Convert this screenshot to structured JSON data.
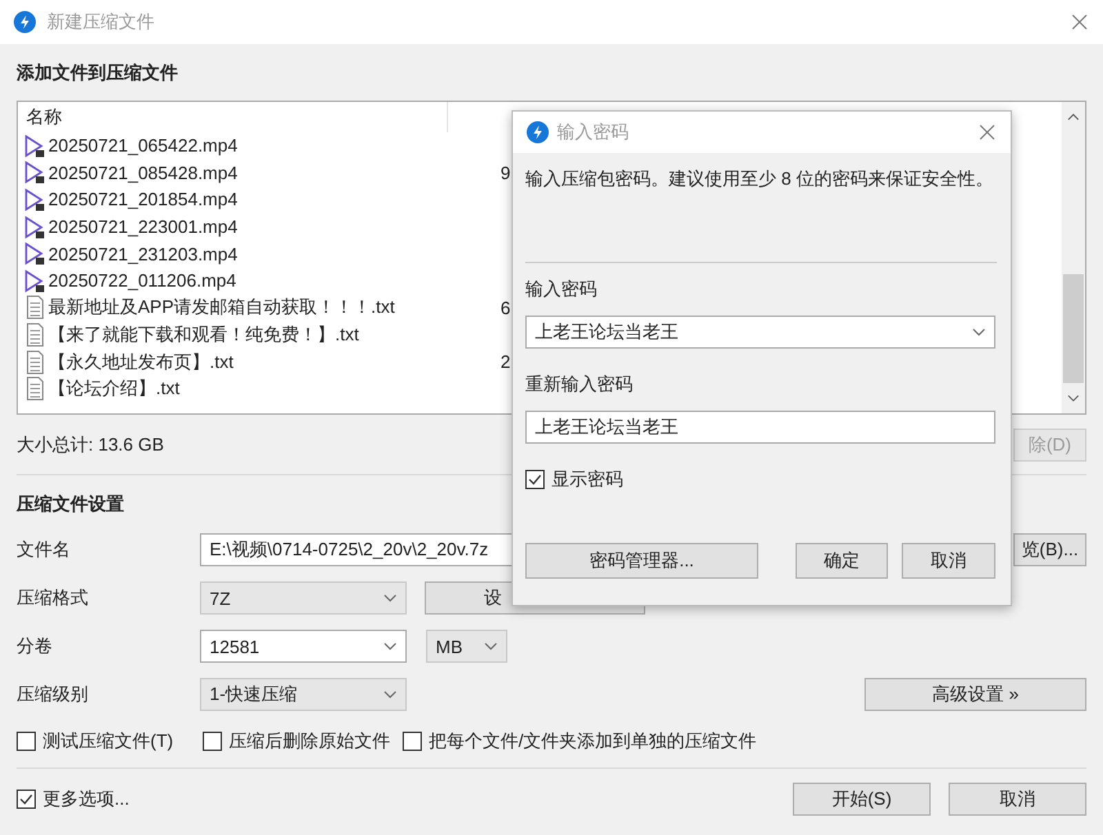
{
  "window": {
    "title": "新建压缩文件"
  },
  "files": {
    "heading": "添加文件到压缩文件",
    "columns": [
      "名称"
    ],
    "rows": [
      {
        "kind": "video",
        "name": "20250721_065422.mp4"
      },
      {
        "kind": "video",
        "name": "20250721_085428.mp4",
        "column_2": "9"
      },
      {
        "kind": "video",
        "name": "20250721_201854.mp4"
      },
      {
        "kind": "video",
        "name": "20250721_223001.mp4"
      },
      {
        "kind": "video",
        "name": "20250721_231203.mp4"
      },
      {
        "kind": "video",
        "name": "20250722_011206.mp4"
      },
      {
        "kind": "text",
        "name": "最新地址及APP请发邮箱自动获取！！！.txt",
        "column_2": "6"
      },
      {
        "kind": "text",
        "name": "【来了就能下载和观看！纯免费！】.txt"
      },
      {
        "kind": "text",
        "name": "【永久地址发布页】.txt",
        "column_2": "2"
      },
      {
        "kind": "text",
        "name": "【论坛介绍】.txt"
      }
    ]
  },
  "total_size": "大小总计: 13.6 GB",
  "delete_button": {
    "label": "除(D)",
    "disabled": true
  },
  "settings": {
    "heading": "压缩文件设置",
    "filename": {
      "label": "文件名",
      "value": "E:\\视频\\0714-0725\\2_20v\\2_20v.7z",
      "button": "览(B)..."
    },
    "format": {
      "label": "压缩格式",
      "value": "7Z",
      "editable": false,
      "button": "设"
    },
    "split": {
      "label": "分卷",
      "value": "12581",
      "editable": true,
      "unit": {
        "value": "MB",
        "editable": false
      }
    },
    "level": {
      "label": "压缩级别",
      "value": "1-快速压缩",
      "editable": false,
      "button": "高级设置 »"
    }
  },
  "options": [
    {
      "label": "测试压缩文件(T)",
      "checked": false
    },
    {
      "label": "压缩后删除原始文件",
      "checked": false
    },
    {
      "label": "把每个文件/文件夹添加到单独的压缩文件",
      "checked": false
    }
  ],
  "more_options": {
    "label": "更多选项...",
    "checked": true
  },
  "buttons": [
    "开始(S)",
    "取消"
  ],
  "dialog": {
    "title": "输入密码",
    "description": "输入压缩包密码。建议使用至少 8 位的密码来保证安全性。",
    "password_label": "输入密码",
    "password": "上老王论坛当老王",
    "confirm_label": "重新输入密码",
    "confirm": "上老王论坛当老王",
    "show_password": {
      "label": "显示密码",
      "checked": true
    },
    "buttons": [
      "密码管理器...",
      "确定",
      "取消"
    ]
  }
}
